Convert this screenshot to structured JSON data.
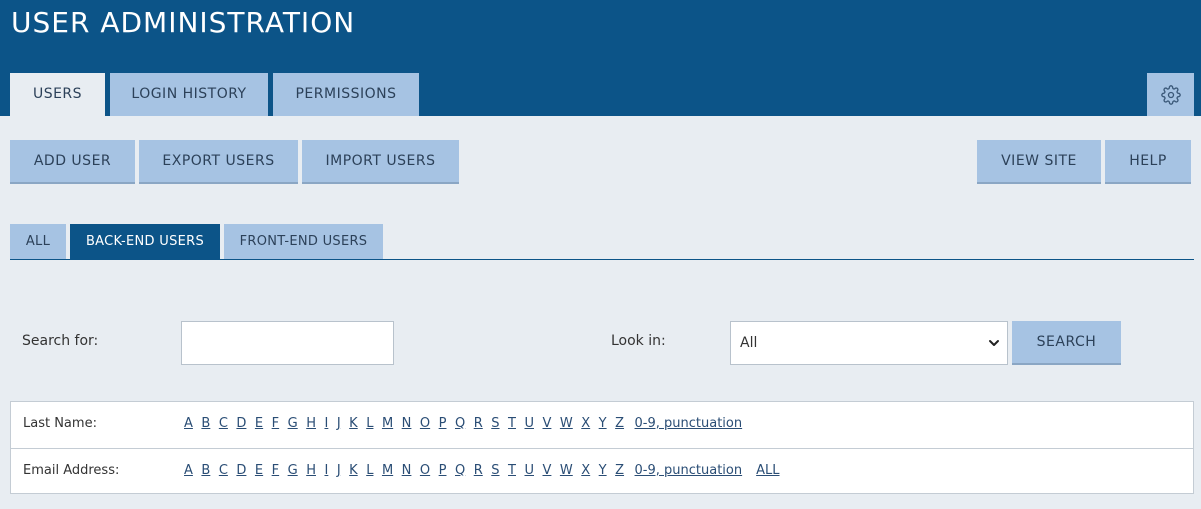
{
  "header": {
    "title": "USER ADMINISTRATION",
    "tabs": [
      {
        "label": "USERS",
        "active": true
      },
      {
        "label": "LOGIN HISTORY",
        "active": false
      },
      {
        "label": "PERMISSIONS",
        "active": false
      }
    ],
    "settings_icon": "gear-icon"
  },
  "toolbar": {
    "add_user": "ADD USER",
    "export_users": "EXPORT USERS",
    "import_users": "IMPORT USERS",
    "view_site": "VIEW SITE",
    "help": "HELP"
  },
  "filter_tabs": [
    {
      "label": "ALL",
      "active": false
    },
    {
      "label": "BACK-END USERS",
      "active": true
    },
    {
      "label": "FRONT-END USERS",
      "active": false
    }
  ],
  "search": {
    "label": "Search for:",
    "value": "",
    "look_in_label": "Look in:",
    "look_in_selected": "All",
    "button": "SEARCH"
  },
  "alpha_index": {
    "letters": [
      "A",
      "B",
      "C",
      "D",
      "E",
      "F",
      "G",
      "H",
      "I",
      "J",
      "K",
      "L",
      "M",
      "N",
      "O",
      "P",
      "Q",
      "R",
      "S",
      "T",
      "U",
      "V",
      "W",
      "X",
      "Y",
      "Z"
    ],
    "rows": [
      {
        "label": "Last Name:",
        "extras": [
          "0-9, punctuation"
        ]
      },
      {
        "label": "Email Address:",
        "extras": [
          "0-9, punctuation",
          "ALL"
        ]
      }
    ]
  },
  "colors": {
    "brand": "#0c5488",
    "tab_bg": "#a6c3e3",
    "page_bg": "#e8edf2",
    "link": "#2a4d75"
  }
}
